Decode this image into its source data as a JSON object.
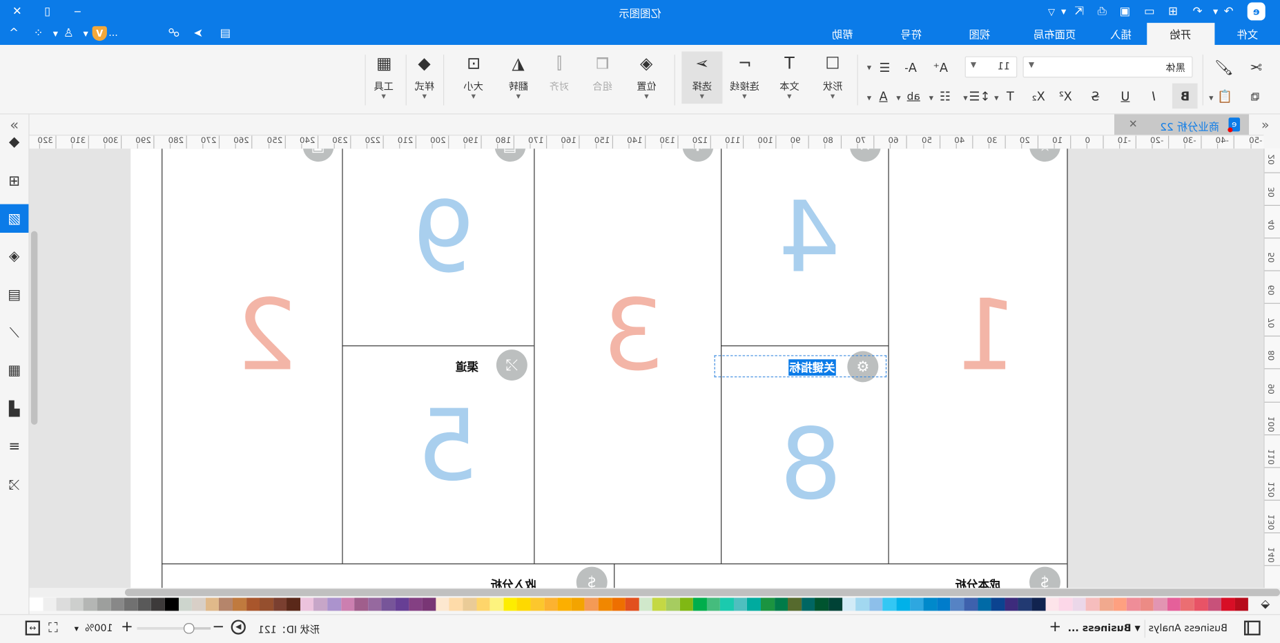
{
  "window": {
    "title": "亿图图示",
    "brand_color": "#0b7be8"
  },
  "quick_access": {
    "more": "..."
  },
  "ribbon_tabs": [
    {
      "label": "文件"
    },
    {
      "label": "开始",
      "active": true
    },
    {
      "label": "插入"
    },
    {
      "label": "页面布局"
    },
    {
      "label": "视图"
    },
    {
      "label": "符号"
    },
    {
      "label": "帮助"
    }
  ],
  "toolbar": {
    "big_buttons": [
      {
        "label": "形状",
        "icon": "rectangle-icon"
      },
      {
        "label": "文本",
        "icon": "text-icon"
      },
      {
        "label": "连接线",
        "icon": "connector-icon"
      },
      {
        "label": "选择",
        "icon": "select-icon",
        "active": true
      },
      {
        "label": "位置",
        "icon": "layers-icon"
      },
      {
        "label": "组合",
        "icon": "group-icon",
        "disabled": true
      },
      {
        "label": "对齐",
        "icon": "align-icon",
        "disabled": true
      },
      {
        "label": "翻转",
        "icon": "flip-icon"
      },
      {
        "label": "大小",
        "icon": "size-icon"
      },
      {
        "label": "样式",
        "icon": "fill-style-icon"
      },
      {
        "label": "工具",
        "icon": "tools-icon"
      }
    ],
    "font_family": "黑体",
    "font_size": "11"
  },
  "document_tab": {
    "title": "商业分析 22"
  },
  "rulers": {
    "horizontal": [
      -50,
      -40,
      -30,
      -20,
      -10,
      0,
      10,
      20,
      30,
      40,
      50,
      60,
      70,
      80,
      90,
      100,
      110,
      120,
      130,
      140,
      150,
      160,
      170,
      180,
      190,
      200,
      210,
      220,
      230,
      240,
      250,
      260,
      270,
      280,
      290,
      300,
      310,
      320
    ],
    "vertical": [
      20,
      30,
      40,
      50,
      60,
      70,
      80,
      90,
      100,
      110,
      120,
      130,
      140
    ]
  },
  "canvas": {
    "numbers": [
      "1",
      "2",
      "3",
      "4",
      "5",
      "8",
      "9"
    ],
    "labels": {
      "channels": "渠道",
      "key_metrics": "关键指标",
      "revenue": "收入分析",
      "cost": "成本分析"
    },
    "selected_label": "关键指标",
    "colors": {
      "red_number": "#f3b5a7",
      "blue_number": "#a9cfee",
      "icon_circle": "#bcbfbf",
      "selection": "#0b7be8"
    }
  },
  "palette": [
    "#ffffff",
    "#efefef",
    "#dcdcdc",
    "#cdcfcd",
    "#b4b6b4",
    "#9d9f9d",
    "#888888",
    "#717171",
    "#595959",
    "#3d3a3a",
    "#000000",
    "#cdd5cd",
    "#d8cfc7",
    "#e0b98a",
    "#b5856b",
    "#c07a3e",
    "#a9562c",
    "#954f2e",
    "#7a3f30",
    "#5a2819",
    "#ecc3dd",
    "#c7a6c8",
    "#ab93cd",
    "#cc7fb0",
    "#a05e8c",
    "#96699f",
    "#775599",
    "#673f95",
    "#844083",
    "#793675",
    "#fde8d0",
    "#fedba9",
    "#eacb97",
    "#fed56a",
    "#fdf37e",
    "#fded00",
    "#fed900",
    "#fcc72d",
    "#fcb231",
    "#fcaf00",
    "#f3a400",
    "#f49a56",
    "#f18700",
    "#ee6f00",
    "#e2501e",
    "#d0e8cb",
    "#c4d844",
    "#a6cc60",
    "#80b814",
    "#00ae4c",
    "#45bc7d",
    "#1bcaae",
    "#4fbfbf",
    "#00ab9f",
    "#1b9440",
    "#007b49",
    "#566a2d",
    "#006662",
    "#00542f",
    "#004236",
    "#d1ebf7",
    "#a2d8f0",
    "#8dbfea",
    "#33c7f4",
    "#00b1e9",
    "#2ea7e0",
    "#0089cb",
    "#007ccb",
    "#5683c4",
    "#3e61ad",
    "#006aa6",
    "#0b4390",
    "#3d2b7c",
    "#223a72",
    "#11234f",
    "#fde4ea",
    "#fcd7e8",
    "#ebd7e9",
    "#f6bdbd",
    "#f1a98e",
    "#fea080",
    "#ef8d98",
    "#ec8b85",
    "#e295b2",
    "#e5609a",
    "#eb6e72",
    "#e85366",
    "#c8517a",
    "#d80e26",
    "#b70c1c"
  ],
  "status": {
    "zoom": "100%",
    "shape_id": "形状 ID：121",
    "page_tabs": [
      {
        "label": "Business Analys"
      },
      {
        "label": "Business ...",
        "active": true
      }
    ]
  }
}
